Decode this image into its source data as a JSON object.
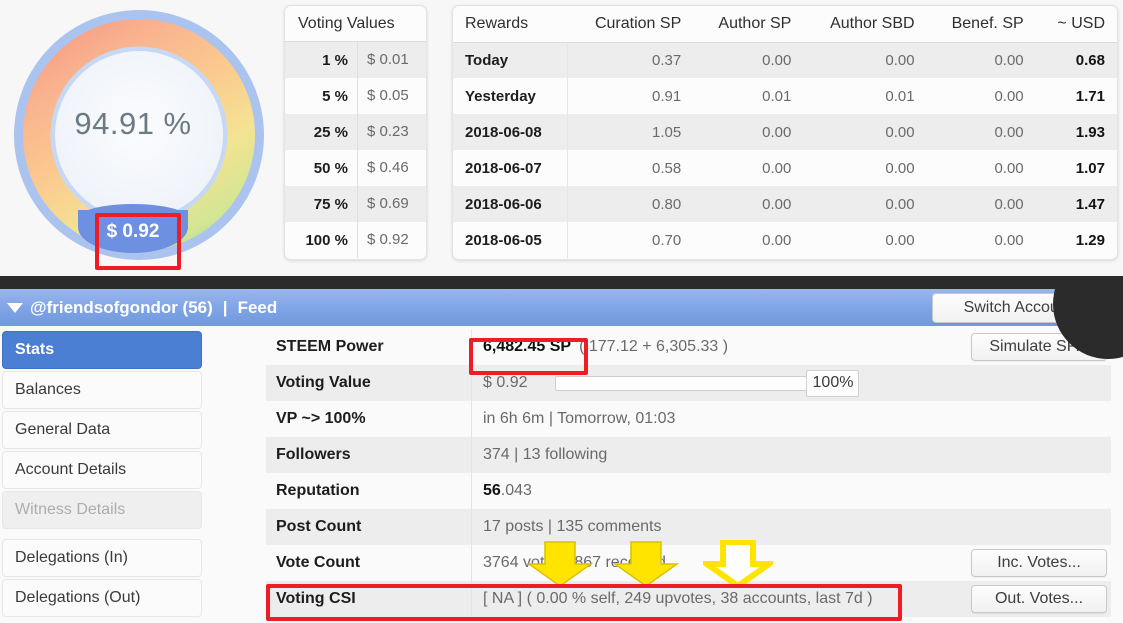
{
  "gauge": {
    "percent_label": "94.91 %",
    "percent_value": 94.91,
    "chip_value": "$ 0.92",
    "track_color": "#aac4ef",
    "gradient_start": "#f6a088",
    "gradient_end": "#bce08e"
  },
  "voting_values": {
    "title": "Voting Values",
    "rows": [
      {
        "percent": "1 %",
        "amount": "$ 0.01"
      },
      {
        "percent": "5 %",
        "amount": "$ 0.05"
      },
      {
        "percent": "25 %",
        "amount": "$ 0.23"
      },
      {
        "percent": "50 %",
        "amount": "$ 0.46"
      },
      {
        "percent": "75 %",
        "amount": "$ 0.69"
      },
      {
        "percent": "100 %",
        "amount": "$ 0.92"
      }
    ]
  },
  "rewards": {
    "columns": [
      "Rewards",
      "Curation SP",
      "Author SP",
      "Author SBD",
      "Benef. SP",
      "~ USD"
    ],
    "rows": [
      {
        "day": "Today",
        "curation_sp": "0.37",
        "author_sp": "0.00",
        "author_sbd": "0.00",
        "benef_sp": "0.00",
        "usd": "0.68"
      },
      {
        "day": "Yesterday",
        "curation_sp": "0.91",
        "author_sp": "0.01",
        "author_sbd": "0.01",
        "benef_sp": "0.00",
        "usd": "1.71"
      },
      {
        "day": "2018-06-08",
        "curation_sp": "1.05",
        "author_sp": "0.00",
        "author_sbd": "0.00",
        "benef_sp": "0.00",
        "usd": "1.93"
      },
      {
        "day": "2018-06-07",
        "curation_sp": "0.58",
        "author_sp": "0.00",
        "author_sbd": "0.00",
        "benef_sp": "0.00",
        "usd": "1.07"
      },
      {
        "day": "2018-06-06",
        "curation_sp": "0.80",
        "author_sp": "0.00",
        "author_sbd": "0.00",
        "benef_sp": "0.00",
        "usd": "1.47"
      },
      {
        "day": "2018-06-05",
        "curation_sp": "0.70",
        "author_sp": "0.00",
        "author_sbd": "0.00",
        "benef_sp": "0.00",
        "usd": "1.29"
      }
    ]
  },
  "account_bar": {
    "name": "@friendsofgondor (56)",
    "separator": "|",
    "section": "Feed",
    "switch_account_label": "Switch Account..."
  },
  "sidebar": {
    "items": [
      {
        "label": "Stats",
        "state": "active"
      },
      {
        "label": "Balances",
        "state": "normal"
      },
      {
        "label": "General Data",
        "state": "normal"
      },
      {
        "label": "Account Details",
        "state": "normal"
      },
      {
        "label": "Witness Details",
        "state": "disabled"
      },
      {
        "label": "Delegations (In)",
        "state": "normal"
      },
      {
        "label": "Delegations (Out)",
        "state": "normal"
      }
    ]
  },
  "stats": {
    "rows": [
      {
        "label": "STEEM Power",
        "value_strong": "6,482.45 SP",
        "value_rest": "( 177.12 + 6,305.33 )",
        "button": "Simulate SP..."
      },
      {
        "label": "Voting Value",
        "value_strong": "$ 0.92",
        "slider_percent": "100%",
        "slider_fill": 0
      },
      {
        "label": "VP ~> 100%",
        "value_rest": "in 6h 6m | Tomorrow, 01:03"
      },
      {
        "label": "Followers",
        "value_rest": "374 | 13 following"
      },
      {
        "label": "Reputation",
        "value_strong": "56",
        "value_rest": ".043"
      },
      {
        "label": "Post Count",
        "value_rest": "17 posts | 135 comments"
      },
      {
        "label": "Vote Count",
        "value_rest": "3764 votes | 867 received",
        "button": "Inc. Votes..."
      },
      {
        "label": "Voting CSI",
        "value_rest": "[ NA ] ( 0.00 % self, 249 upvotes, 38 accounts, last 7d )",
        "button": "Out. Votes..."
      }
    ]
  },
  "annotations": {
    "highlight_color": "#ee1c25",
    "arrow_color": "#ffe400",
    "highlights": [
      "voting-value-chip",
      "steem-power-value",
      "voting-csi-row"
    ],
    "arrows": 3
  }
}
